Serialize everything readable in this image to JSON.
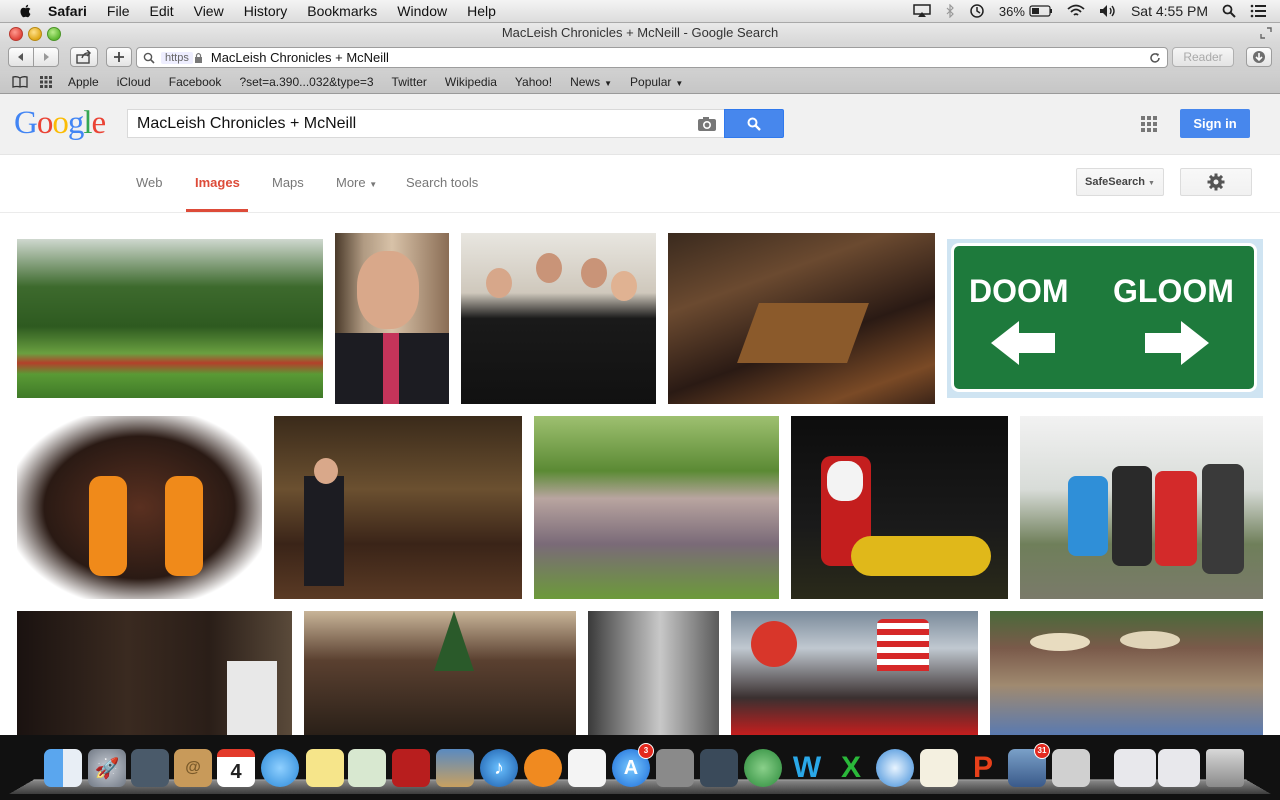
{
  "menubar": {
    "app_name": "Safari",
    "menus": [
      "File",
      "Edit",
      "View",
      "History",
      "Bookmarks",
      "Window",
      "Help"
    ],
    "battery": "36%",
    "clock": "Sat 4:55 PM"
  },
  "window": {
    "title": "MacLeish Chronicles + McNeill - Google Search",
    "url_scheme": "https",
    "url": "MacLeish Chronicles + McNeill",
    "reader_label": "Reader"
  },
  "bookmarks": [
    "Apple",
    "iCloud",
    "Facebook",
    "?set=a.390...032&type=3",
    "Twitter",
    "Wikipedia",
    "Yahoo!",
    "News",
    "Popular"
  ],
  "google": {
    "logo": "Google",
    "query": "MacLeish Chronicles + McNeill",
    "sign_in": "Sign in"
  },
  "nav": {
    "tabs": [
      "Web",
      "Images",
      "Maps",
      "More",
      "Search tools"
    ],
    "active": "Images",
    "safesearch": "SafeSearch"
  },
  "results": {
    "sign_text": [
      "DOOM",
      "GLOOM"
    ],
    "row1": [
      "garden-welcome-sign",
      "man-in-suit-portrait",
      "couples-in-black",
      "restaurant-party",
      "doom-gloom-sign"
    ],
    "row2": [
      "christmas-moose-lights",
      "dinner-party-tables",
      "large-family-group",
      "santa-on-motorcycle",
      "four-hikers-coastline"
    ],
    "row3": [
      "formal-group-photo",
      "christmas-family-gathering",
      "black-white-street",
      "uncle-sam-hat-crowd",
      "three-elderly-in-hats"
    ]
  },
  "dock": {
    "calendar_day": "4",
    "appstore_badge": "3",
    "mail_badge": "31"
  }
}
